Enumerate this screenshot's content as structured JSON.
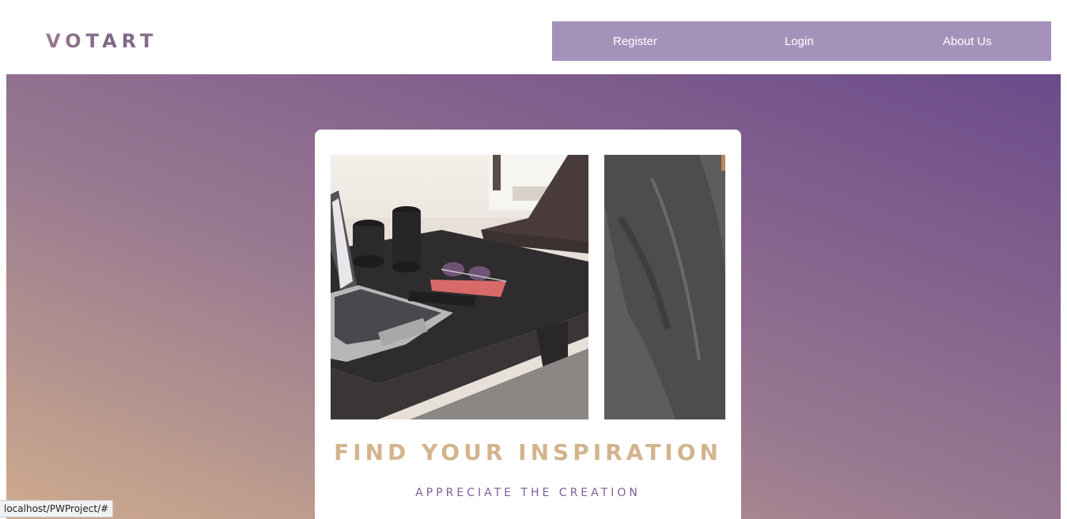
{
  "header": {
    "logo": "VOTART",
    "nav": {
      "register": "Register",
      "login": "Login",
      "about": "About Us"
    }
  },
  "hero": {
    "headline": "FIND YOUR INSPIRATION",
    "subline": "APPRECIATE THE CREATION"
  },
  "status_bar": {
    "url": "localhost/PWProject/#"
  },
  "colors": {
    "nav_background": "#a592bb",
    "headline": "#d3b48c",
    "subline": "#7b5f96",
    "gradient_top": "#6b4b8a",
    "gradient_bottom": "#d0ab8d"
  }
}
